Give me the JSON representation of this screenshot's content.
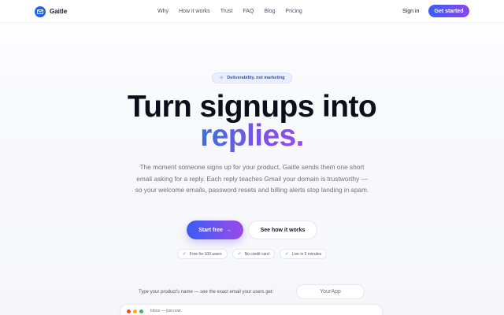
{
  "nav": {
    "brand": "Gaitle",
    "links": [
      "Why",
      "How it works",
      "Trust",
      "FAQ",
      "Blog",
      "Pricing"
    ],
    "signin": "Sign in",
    "cta": "Get started"
  },
  "hero": {
    "pill": "Deliverability, not marketing",
    "headline_line1": "Turn signups into",
    "headline_line2": "replies.",
    "subtitle": "The moment someone signs up for your product, Gaitle sends them one short email asking for a reply. Each reply teaches Gmail your domain is trustworthy — so your welcome emails, password resets and billing alerts stop landing in spam.",
    "primary_cta": "Start free",
    "primary_cta_arrow": "→",
    "secondary_cta": "See how it works",
    "chips": [
      "Free for 100 users",
      "No credit card",
      "Live in 5 minutes"
    ]
  },
  "demo": {
    "prompt": "Type your product's name — see the exact email your users get:",
    "input_placeholder": "YourApp",
    "preview_label": "Inbox — just now"
  },
  "colors": {
    "accent_blue": "#3b5cf6",
    "accent_purple": "#8b47ea",
    "brand_logo": "#1d63e8"
  },
  "icons": {
    "brand": "mail-icon",
    "pill": "sparkle-icon",
    "chip": "check-icon",
    "arrow": "arrow-right-icon"
  }
}
